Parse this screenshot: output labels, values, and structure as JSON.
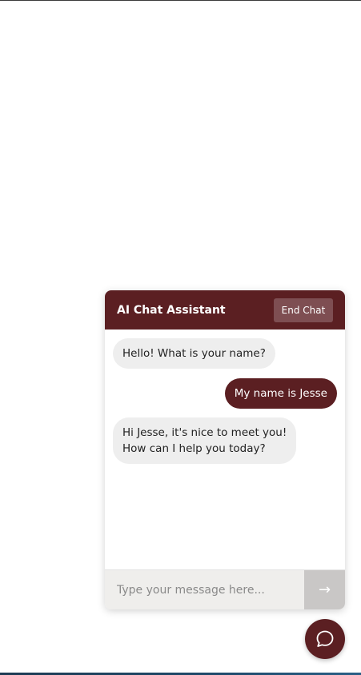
{
  "chat": {
    "title": "AI Chat Assistant",
    "end_chat_label": "End Chat",
    "messages": [
      {
        "sender": "bot",
        "text": "Hello! What is your name?"
      },
      {
        "sender": "user",
        "text": "My name is Jesse"
      },
      {
        "sender": "bot",
        "text": "Hi Jesse, it's nice to meet you!\nHow can I help you today?"
      }
    ],
    "input_placeholder": "Type your message here...",
    "input_value": "",
    "send_icon": "→"
  },
  "launcher": {
    "icon": "chat-bubble-icon"
  },
  "colors": {
    "brand": "#5b1f22",
    "bot_bubble": "#eeeeee",
    "send_button_disabled": "#c9c7c6"
  }
}
